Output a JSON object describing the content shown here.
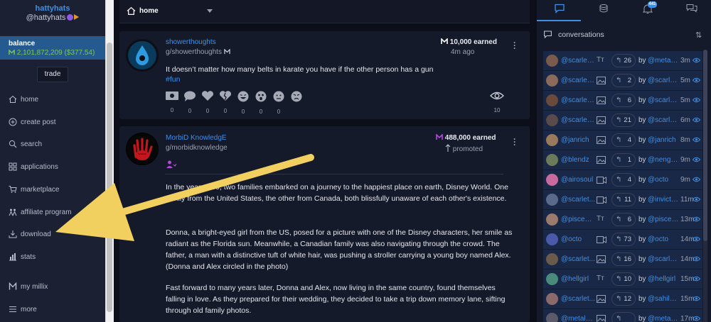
{
  "profile": {
    "name": "hattyhats",
    "handle": "@hattyhats"
  },
  "balance": {
    "label": "balance",
    "value": "2,101,872,209 ($377.54)"
  },
  "trade_label": "trade",
  "nav": [
    {
      "label": "home",
      "icon": "home-icon"
    },
    {
      "label": "create post",
      "icon": "plus-circle-icon"
    },
    {
      "label": "search",
      "icon": "search-icon"
    },
    {
      "label": "applications",
      "icon": "grid-icon"
    },
    {
      "label": "marketplace",
      "icon": "cart-icon"
    },
    {
      "label": "affiliate program",
      "icon": "people-icon"
    },
    {
      "label": "download",
      "icon": "download-icon"
    },
    {
      "label": "stats",
      "icon": "bar-chart-icon"
    },
    {
      "label": "my millix",
      "icon": "millix-icon"
    },
    {
      "label": "more",
      "icon": "menu-icon"
    }
  ],
  "feed_header": {
    "label": "home"
  },
  "posts": [
    {
      "author": "showerthoughts",
      "group": "g/showerthoughts",
      "earned": "10,000 earned",
      "time": "4m ago",
      "text": "It doesn’t matter how many belts in karate you have if the other person has a gun",
      "tag": "#fun",
      "reactions": [
        "0",
        "0",
        "0",
        "0",
        "0",
        "0",
        "0"
      ],
      "views": "10"
    },
    {
      "author": "MorbiD KnowledgE",
      "group": "g/morbidknowledge",
      "earned": "488,000 earned",
      "status": "promoted",
      "paragraphs": [
        "In the year 1960, two families embarked on a journey to the happiest place on earth, Disney World. One family from the United States, the other from Canada, both blissfully unaware of each other's existence.",
        "Donna, a bright-eyed girl from the US, posed for a picture with one of the Disney characters, her smile as radiant as the Florida sun. Meanwhile, a Canadian family was also navigating through the crowd. The father, a man with a distinctive tuft of white hair, was pushing a stroller carrying a young boy named Alex. (Donna and Alex circled in the photo)",
        "Fast forward to many years later, Donna and Alex, now living in the same country, found themselves falling in love. As they prepared for their wedding, they decided to take a trip down memory lane, sifting through old family photos."
      ]
    }
  ],
  "right_panel": {
    "notification_count": "441",
    "title": "conversations",
    "conversations": [
      {
        "user": "@scarletd...",
        "type": "text",
        "count": "26",
        "by": "by",
        "by_user": "@metalpa...",
        "time": "3m"
      },
      {
        "user": "@scarletdol",
        "type": "image",
        "count": "2",
        "by": "by",
        "by_user": "@scarletdol",
        "time": "5m"
      },
      {
        "user": "@scarletdol",
        "type": "image",
        "count": "6",
        "by": "by",
        "by_user": "@scarletdol",
        "time": "5m"
      },
      {
        "user": "@scarletd...",
        "type": "image",
        "count": "21",
        "by": "by",
        "by_user": "@scarletd...",
        "time": "6m"
      },
      {
        "user": "@janrich",
        "type": "image",
        "count": "4",
        "by": "by",
        "by_user": "@janrich",
        "time": "8m"
      },
      {
        "user": "@blendz",
        "type": "image",
        "count": "1",
        "by": "by",
        "by_user": "@nengste",
        "time": "9m"
      },
      {
        "user": "@airosoul",
        "type": "video",
        "count": "4",
        "by": "by",
        "by_user": "@octo",
        "time": "9m"
      },
      {
        "user": "@scarlet...",
        "type": "video",
        "count": "11",
        "by": "by",
        "by_user": "@invictus...",
        "time": "11m"
      },
      {
        "user": "@piscesd...",
        "type": "text",
        "count": "6",
        "by": "by",
        "by_user": "@piscesd...",
        "time": "13m"
      },
      {
        "user": "@octo",
        "type": "video",
        "count": "73",
        "by": "by",
        "by_user": "@octo",
        "time": "14m"
      },
      {
        "user": "@scarlet...",
        "type": "image",
        "count": "16",
        "by": "by",
        "by_user": "@scarlet...",
        "time": "14m"
      },
      {
        "user": "@hellgirl",
        "type": "text",
        "count": "10",
        "by": "by",
        "by_user": "@hellgirl",
        "time": "15m"
      },
      {
        "user": "@scarlet...",
        "type": "image",
        "count": "12",
        "by": "by",
        "by_user": "@sahilnaj...",
        "time": "15m"
      },
      {
        "user": "@metalpa...",
        "type": "image",
        "count": "",
        "by": "by",
        "by_user": "@metalpa...",
        "time": "17m"
      }
    ]
  },
  "colors": {
    "accent": "#3f8fe8",
    "balance_bg": "#255a90",
    "balance_value": "#7ec45a",
    "millix_purple": "#b04ad8"
  }
}
